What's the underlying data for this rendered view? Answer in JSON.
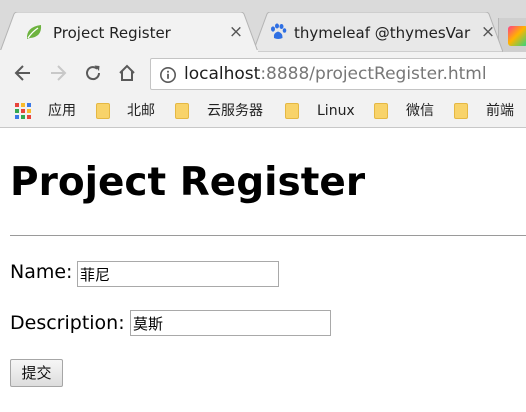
{
  "browser": {
    "tabs": [
      {
        "title": "Project Register",
        "favicon": "spring-leaf-icon",
        "active": true
      },
      {
        "title": "thymeleaf @thymesVar",
        "favicon": "baidu-paw-icon",
        "active": false
      },
      {
        "title": "",
        "favicon": "intellij-icon",
        "active": false
      }
    ],
    "close_glyph": "×",
    "address_bar": {
      "url_host": "localhost",
      "url_rest": ":8888/projectRegister.html"
    },
    "bookmarks": [
      {
        "label": "应用",
        "icon": "apps-grid-icon"
      },
      {
        "label": "北邮",
        "icon": "folder-icon"
      },
      {
        "label": "云服务器",
        "icon": "folder-icon"
      },
      {
        "label": "Linux",
        "icon": "folder-icon"
      },
      {
        "label": "微信",
        "icon": "folder-icon"
      },
      {
        "label": "前端",
        "icon": "folder-icon"
      }
    ]
  },
  "page": {
    "title": "Project Register",
    "form": {
      "name_label": "Name:",
      "name_value": "菲尼",
      "description_label": "Description:",
      "description_value": "莫斯",
      "submit_label": "提交"
    }
  }
}
